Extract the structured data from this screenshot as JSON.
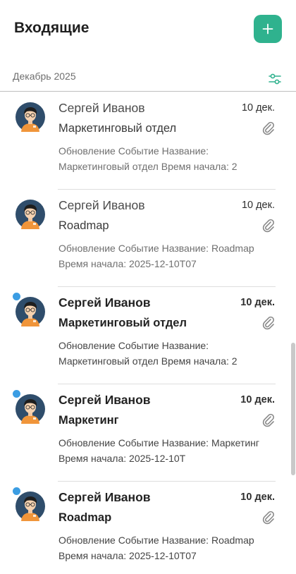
{
  "header": {
    "title": "Входящие",
    "compose_icon": "plus-icon"
  },
  "month_bar": {
    "label": "Декабрь 2025",
    "filter_icon": "sliders-icon"
  },
  "colors": {
    "accent": "#2fb28e",
    "unread": "#3b9de3"
  },
  "messages": [
    {
      "sender": "Сергей Иванов",
      "date": "10 дек.",
      "subject": "Маркетинговый отдел",
      "preview_line1": "Обновление Событие Название:",
      "preview_line2": "Маркетинговый отдел Время начала: 2",
      "unread": false,
      "has_attachment": true
    },
    {
      "sender": "Сергей Иванов",
      "date": "10 дек.",
      "subject": "Roadmap",
      "preview_line1": "Обновление Событие Название: Roadmap",
      "preview_line2": "Время начала: 2025-12-10T07",
      "unread": false,
      "has_attachment": true
    },
    {
      "sender": "Сергей Иванов",
      "date": "10 дек.",
      "subject": "Маркетинговый отдел",
      "preview_line1": "Обновление Событие Название:",
      "preview_line2": "Маркетинговый отдел Время начала: 2",
      "unread": true,
      "has_attachment": true
    },
    {
      "sender": "Сергей Иванов",
      "date": "10 дек.",
      "subject": "Маркетинг",
      "preview_line1": "Обновление Событие Название: Маркетинг",
      "preview_line2": "Время начала: 2025-12-10T",
      "unread": true,
      "has_attachment": true
    },
    {
      "sender": "Сергей Иванов",
      "date": "10 дек.",
      "subject": "Roadmap",
      "preview_line1": "Обновление Событие Название: Roadmap",
      "preview_line2": "Время начала: 2025-12-10T07",
      "unread": true,
      "has_attachment": true
    }
  ]
}
